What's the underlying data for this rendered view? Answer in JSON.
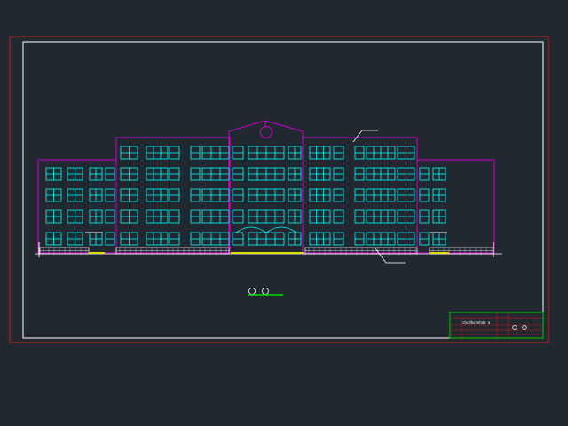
{
  "drawing": {
    "title_block": {
      "title_text": "cbcdhsdehde a",
      "markers": [
        "o",
        "o"
      ]
    },
    "palette": {
      "background": "#212830",
      "outer_border": "#d01818",
      "inner_border": "#ffffff",
      "wall_outline": "#d000d0",
      "windows": "#00ffff",
      "ground": "#e0e000",
      "title_block_frame": "#00cc00",
      "title_block_rows": "#d01818",
      "annotations": "#ffffff"
    },
    "elevation": {
      "floors": 5,
      "blocks": [
        "left-wing",
        "left-main",
        "center-entrance",
        "right-main",
        "right-wing"
      ]
    }
  }
}
